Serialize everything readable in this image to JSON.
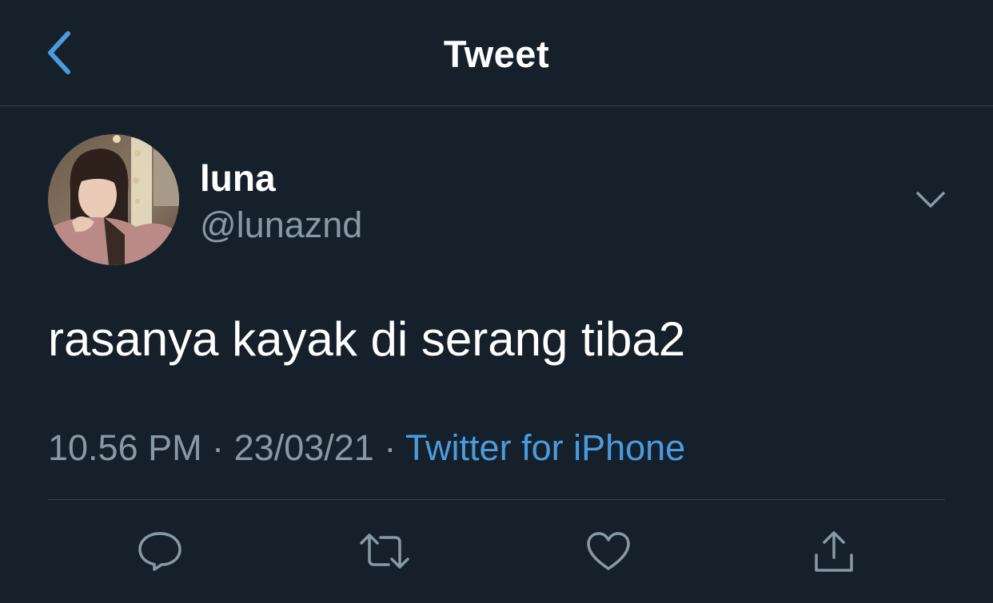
{
  "header": {
    "title": "Tweet",
    "back_icon": "chevron-left-icon"
  },
  "tweet": {
    "author": {
      "display_name": "luna",
      "handle": "@lunaznd",
      "avatar": "profile-photo"
    },
    "text": "rasanya kayak di serang tiba2",
    "time": "10.56 PM",
    "date": "23/03/21",
    "separator": "·",
    "source": "Twitter for iPhone"
  },
  "actions": [
    {
      "name": "reply",
      "icon": "reply-icon"
    },
    {
      "name": "retweet",
      "icon": "retweet-icon"
    },
    {
      "name": "like",
      "icon": "heart-icon"
    },
    {
      "name": "share",
      "icon": "share-icon"
    }
  ],
  "colors": {
    "background": "#15202b",
    "accent": "#4a9cdf",
    "secondary_text": "#8899a6",
    "divider": "#38444d"
  }
}
